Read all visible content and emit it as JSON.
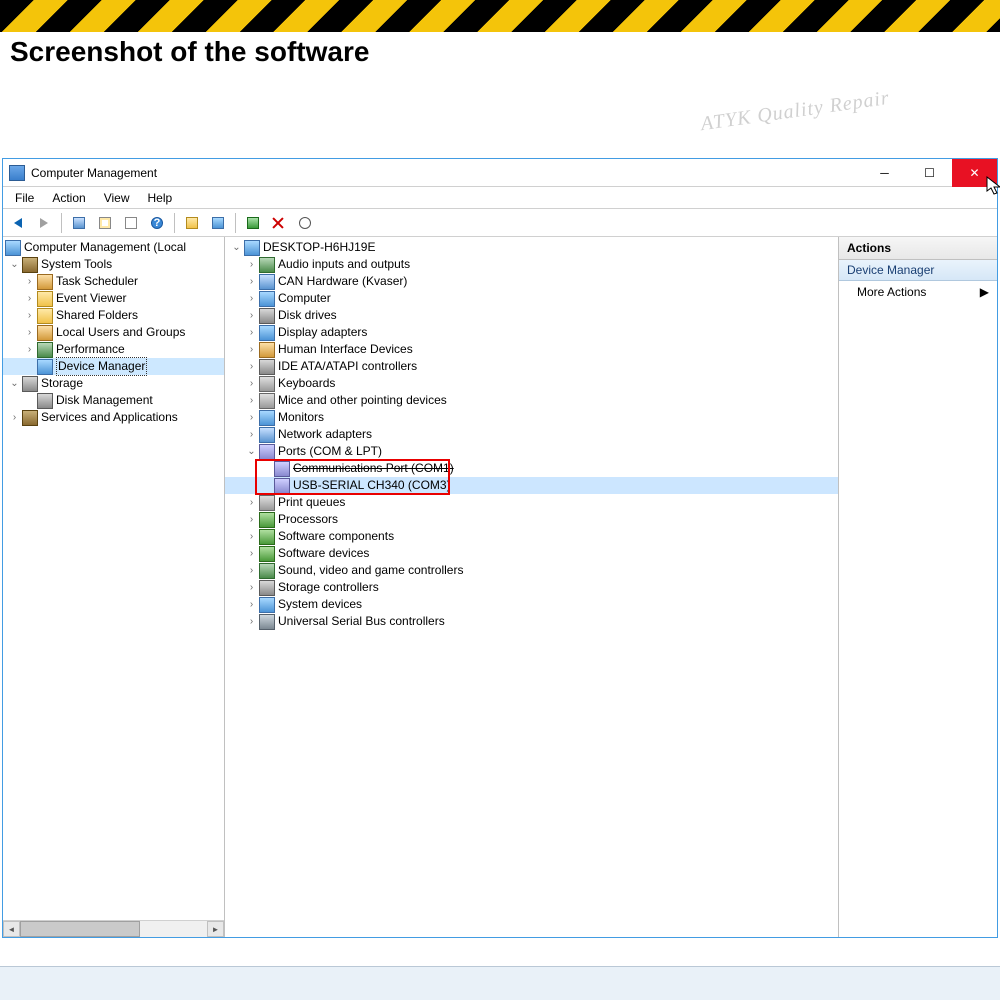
{
  "banner": {
    "title": "Screenshot of the software"
  },
  "watermark": "ATYK Quality Repair",
  "window": {
    "title": "Computer Management",
    "menu": [
      "File",
      "Action",
      "View",
      "Help"
    ]
  },
  "left_tree": {
    "root": "Computer Management (Local",
    "system_tools": {
      "label": "System Tools",
      "items": [
        "Task Scheduler",
        "Event Viewer",
        "Shared Folders",
        "Local Users and Groups",
        "Performance",
        "Device Manager"
      ]
    },
    "storage": {
      "label": "Storage",
      "items": [
        "Disk Management"
      ]
    },
    "services": {
      "label": "Services and Applications"
    }
  },
  "device_tree": {
    "root": "DESKTOP-H6HJ19E",
    "items": [
      "Audio inputs and outputs",
      "CAN Hardware (Kvaser)",
      "Computer",
      "Disk drives",
      "Display adapters",
      "Human Interface Devices",
      "IDE ATA/ATAPI controllers",
      "Keyboards",
      "Mice and other pointing devices",
      "Monitors",
      "Network adapters"
    ],
    "ports": {
      "label": "Ports (COM & LPT)",
      "children": [
        "Communications Port (COM1)",
        "USB-SERIAL CH340 (COM3)"
      ]
    },
    "items2": [
      "Print queues",
      "Processors",
      "Software components",
      "Software devices",
      "Sound, video and game controllers",
      "Storage controllers",
      "System devices",
      "Universal Serial Bus controllers"
    ]
  },
  "actions": {
    "head": "Actions",
    "sub": "Device Manager",
    "item": "More Actions"
  }
}
